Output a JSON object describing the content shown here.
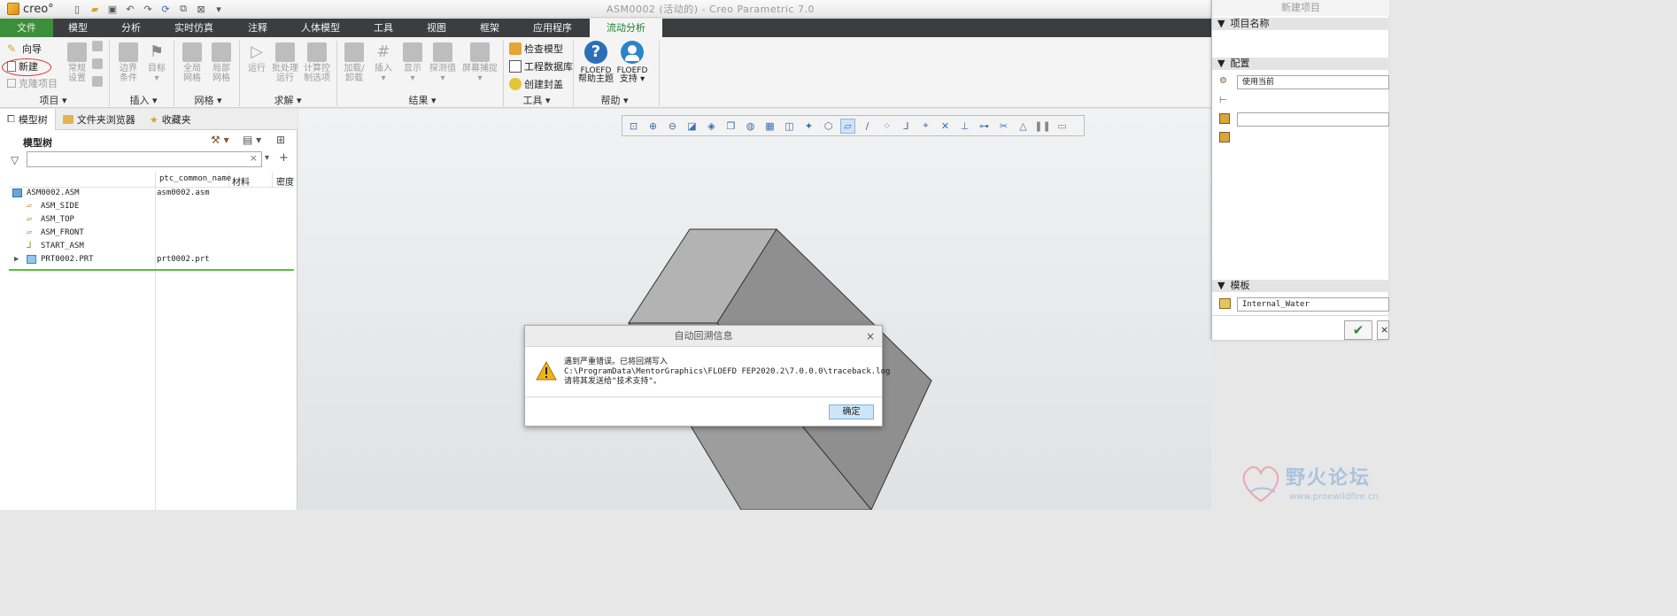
{
  "app": {
    "logo_text": "creo°",
    "window_title": "ASM0002 (活动的) - Creo Parametric 7.0"
  },
  "quick_access": {
    "icons": [
      "new-file-icon",
      "open-folder-icon",
      "save-icon",
      "undo-icon",
      "redo-icon",
      "regenerate-icon",
      "windows-icon",
      "close-window-icon",
      "customize-dropdown-icon"
    ]
  },
  "ribbon_tabs": [
    "文件",
    "模型",
    "分析",
    "实时仿真",
    "注释",
    "人体模型",
    "工具",
    "视图",
    "框架",
    "应用程序",
    "流动分析"
  ],
  "active_tab": "流动分析",
  "ribbon": {
    "project": {
      "wizard": "向导",
      "new": "新建",
      "clone": "克隆项目",
      "general_1": "常规",
      "general_2": "设置",
      "label": "项目"
    },
    "insert": {
      "boundary_1": "边界",
      "boundary_2": "条件",
      "goal": "目标",
      "label": "插入"
    },
    "mesh": {
      "global_1": "全局",
      "global_2": "网格",
      "local_1": "局部",
      "local_2": "网格",
      "label": "网格"
    },
    "solve": {
      "run": "运行",
      "batch_1": "批处理",
      "batch_2": "运行",
      "calc_1": "计算控",
      "calc_2": "制选项",
      "label": "求解"
    },
    "results": {
      "load_1": "加载/",
      "load_2": "卸载",
      "insert": "插入",
      "display": "显示",
      "probe": "探测值",
      "screen": "屏幕捕捉",
      "label": "结果"
    },
    "tools": {
      "check_model": "检查模型",
      "eng_db": "工程数据库",
      "create_lid": "创建封盖",
      "label": "工具"
    },
    "help": {
      "help_1": "FLOEFD",
      "help_2": "帮助主题",
      "support_1": "FLOEFD",
      "support_2": "支持",
      "label": "帮助"
    }
  },
  "navigator": {
    "tabs": [
      "模型树",
      "文件夹浏览器",
      "收藏夹"
    ],
    "tree_title": "模型树",
    "filter_value": "",
    "columns": [
      "ptc_common_name",
      "材料",
      "密度"
    ],
    "rows": [
      {
        "name": "ASM0002.ASM",
        "value": "asm0002.asm",
        "icon": "assembly-icon"
      },
      {
        "name": "ASM_SIDE",
        "value": "",
        "icon": "datum-plane-icon"
      },
      {
        "name": "ASM_TOP",
        "value": "",
        "icon": "datum-plane-icon"
      },
      {
        "name": "ASM_FRONT",
        "value": "",
        "icon": "datum-plane-icon"
      },
      {
        "name": "START_ASM",
        "value": "",
        "icon": "coordinate-system-icon"
      },
      {
        "name": "PRT0002.PRT",
        "value": "prt0002.prt",
        "icon": "part-icon"
      }
    ]
  },
  "dialog": {
    "title": "自动回溯信息",
    "message": "遇到严重错误。已将回溯写入\nC:\\ProgramData\\MentorGraphics\\FLOEFD FEP2020.2\\7.0.0.0\\traceback.log\n请将其发送给\"技术支持\"。",
    "ok": "确定"
  },
  "right_panel": {
    "title": "新建项目",
    "project_name_section": "项目名称",
    "config_section": "配置",
    "config_value": "使用当前",
    "template_section": "模板",
    "template_value": "Internal_Water"
  },
  "watermark": {
    "text": "野火论坛",
    "url": "www.proewildfire.cn"
  },
  "colors": {
    "file_tab": "#3c8e3a",
    "active_tab_text": "#1a7d2e",
    "tab_bar": "#3b3d40",
    "tree_separator": "#5cbd3a",
    "ok_button": "#cde6f7"
  }
}
